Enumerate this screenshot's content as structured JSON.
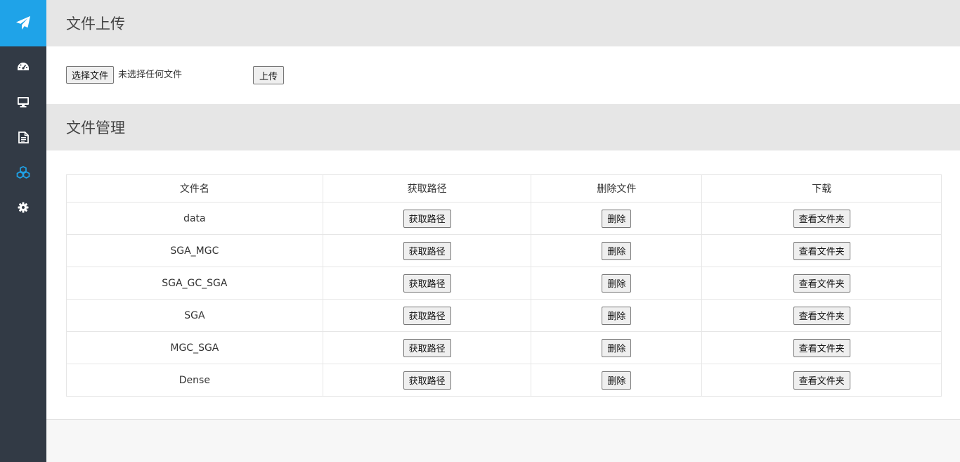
{
  "sidebar": {
    "logo_icon": "paper-plane-icon",
    "active_color": "#1fa3e8",
    "items": [
      {
        "icon": "dashboard-icon",
        "active": false
      },
      {
        "icon": "monitor-icon",
        "active": false
      },
      {
        "icon": "document-icon",
        "active": false
      },
      {
        "icon": "cubes-icon",
        "active": true
      },
      {
        "icon": "settings-gear-icon",
        "active": false
      }
    ]
  },
  "upload": {
    "title": "文件上传",
    "choose_button": "选择文件",
    "no_file_text": "未选择任何文件",
    "upload_button": "上传"
  },
  "manage": {
    "title": "文件管理",
    "columns": [
      "文件名",
      "获取路径",
      "删除文件",
      "下载"
    ],
    "rows": [
      {
        "name": "data",
        "path_button": "获取路径",
        "delete_button": "删除",
        "view_button": "查看文件夹"
      },
      {
        "name": "SGA_MGC",
        "path_button": "获取路径",
        "delete_button": "删除",
        "view_button": "查看文件夹"
      },
      {
        "name": "SGA_GC_SGA",
        "path_button": "获取路径",
        "delete_button": "删除",
        "view_button": "查看文件夹"
      },
      {
        "name": "SGA",
        "path_button": "获取路径",
        "delete_button": "删除",
        "view_button": "查看文件夹"
      },
      {
        "name": "MGC_SGA",
        "path_button": "获取路径",
        "delete_button": "删除",
        "view_button": "查看文件夹"
      },
      {
        "name": "Dense",
        "path_button": "获取路径",
        "delete_button": "删除",
        "view_button": "查看文件夹"
      }
    ]
  }
}
